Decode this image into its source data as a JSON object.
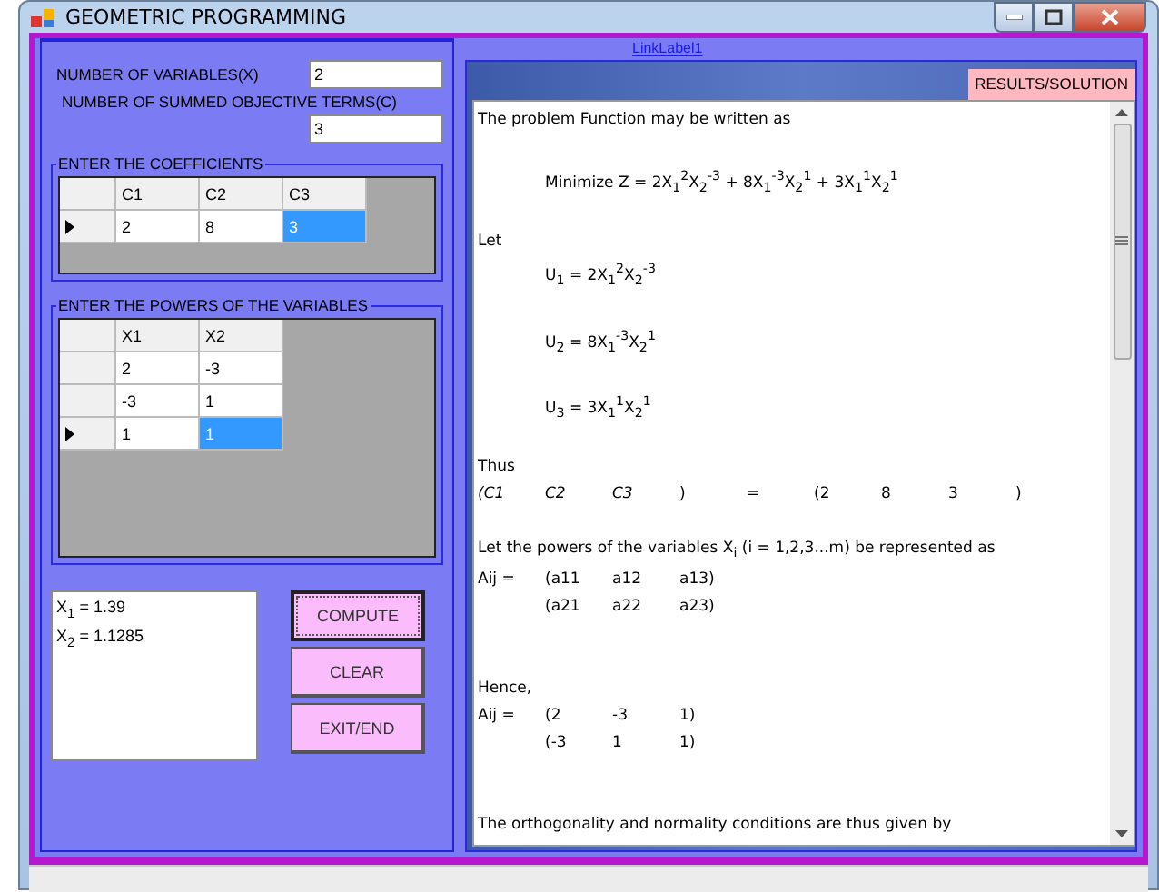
{
  "window": {
    "title": "GEOMETRIC PROGRAMMING"
  },
  "inputs": [
    {
      "label": "NUMBER OF VARIABLES(X)",
      "value": "2"
    },
    {
      "label": "NUMBER OF SUMMED OBJECTIVE TERMS(C)",
      "value": "3"
    }
  ],
  "coefficients": {
    "title": "ENTER THE COEFFICIENTS",
    "columns": [
      "C1",
      "C2",
      "C3"
    ],
    "rows": [
      {
        "current": true,
        "cells": [
          {
            "text": "2",
            "selected": false
          },
          {
            "text": "8",
            "selected": false
          },
          {
            "text": "3",
            "selected": true
          }
        ]
      }
    ]
  },
  "powers": {
    "title": "ENTER THE POWERS OF THE VARIABLES",
    "columns": [
      "X1",
      "X2"
    ],
    "rows": [
      {
        "current": false,
        "cells": [
          {
            "text": "2",
            "selected": false
          },
          {
            "text": "-3",
            "selected": false
          }
        ]
      },
      {
        "current": false,
        "cells": [
          {
            "text": "-3",
            "selected": false
          },
          {
            "text": "1",
            "selected": false
          }
        ]
      },
      {
        "current": true,
        "cells": [
          {
            "text": "1",
            "selected": false
          },
          {
            "text": "1",
            "selected": true
          }
        ]
      }
    ]
  },
  "output": [
    "X$_{1}$ = 1.39",
    "X$_{2}$ = 1.1285"
  ],
  "buttons": [
    {
      "label": "COMPUTE",
      "focused": true
    },
    {
      "label": "CLEAR",
      "focused": false
    },
    {
      "label": "EXIT/END",
      "focused": false
    }
  ],
  "link": "LinkLabel1",
  "results": {
    "label": "RESULTS/SOLUTION",
    "lines": [
      {
        "kind": "text",
        "text": "The problem Function may be written as"
      },
      {
        "kind": "blank"
      },
      {
        "kind": "formula",
        "text": "Minimize Z = 2X$_{1}$$^{2}$X$_{2}$$^{-3}$ + 8X$_{1}$$^{-3}$X$_{2}$$^{1}$ + 3X$_{1}$$^{1}$X$_{2}$$^{1}$"
      },
      {
        "kind": "blank"
      },
      {
        "kind": "text",
        "text": "Let"
      },
      {
        "kind": "formula",
        "text": "U$_{1}$ = 2X$_{1}$$^{2}$X$_{2}$$^{-3}$"
      },
      {
        "kind": "blank"
      },
      {
        "kind": "formula",
        "text": "U$_{2}$ = 8X$_{1}$$^{-3}$X$_{2}$$^{1}$"
      },
      {
        "kind": "blank"
      },
      {
        "kind": "formula",
        "text": "U$_{3}$ = 3X$_{1}$$^{1}$X$_{2}$$^{1}$"
      },
      {
        "kind": "blank"
      },
      {
        "kind": "text",
        "text": "Thus"
      },
      {
        "kind": "row",
        "cells": [
          {
            "text": "(C1",
            "italic": true
          },
          {
            "text": "C2",
            "italic": true
          },
          {
            "text": "C3",
            "italic": true
          },
          {
            "text": ")"
          },
          {
            "text": "="
          },
          {
            "text": "(2"
          },
          {
            "text": "8"
          },
          {
            "text": "3"
          },
          {
            "text": ")"
          }
        ]
      },
      {
        "kind": "blank"
      },
      {
        "kind": "text",
        "text": "Let the powers of the variables X$_{i}$ (i = 1,2,3...m) be represented as"
      },
      {
        "kind": "row",
        "label": "Aij =",
        "cells": [
          {
            "text": "(a11"
          },
          {
            "text": "a12"
          },
          {
            "text": "a13)"
          }
        ]
      },
      {
        "kind": "row",
        "cells": [
          {
            "text": "(a21"
          },
          {
            "text": "a22"
          },
          {
            "text": "a23)"
          }
        ]
      },
      {
        "kind": "blank"
      },
      {
        "kind": "blank"
      },
      {
        "kind": "text",
        "text": "Hence,"
      },
      {
        "kind": "row",
        "label": "Aij =",
        "cells": [
          {
            "text": "(2"
          },
          {
            "text": "-3"
          },
          {
            "text": "1)"
          }
        ]
      },
      {
        "kind": "row",
        "cells": [
          {
            "text": "(-3"
          },
          {
            "text": "1"
          },
          {
            "text": "1)"
          }
        ]
      },
      {
        "kind": "blank"
      },
      {
        "kind": "blank"
      },
      {
        "kind": "text",
        "text": "The orthogonality and normality conditions are thus given by"
      }
    ]
  }
}
